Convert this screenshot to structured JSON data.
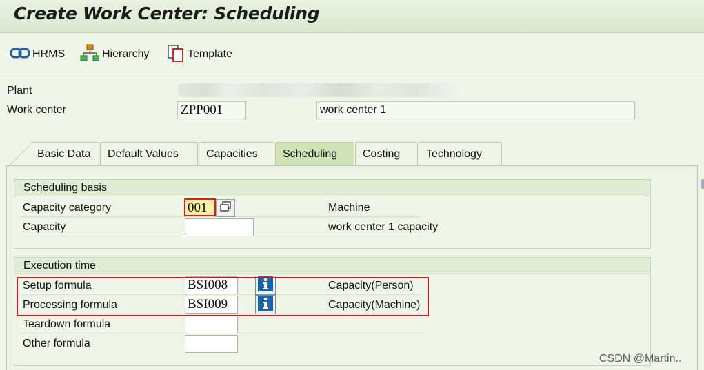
{
  "window": {
    "title": "Create Work Center: Scheduling"
  },
  "toolbar": {
    "hrms_label": "HRMS",
    "hierarchy_label": "Hierarchy",
    "template_label": "Template"
  },
  "header": {
    "plant_label": "Plant",
    "work_center_label": "Work center",
    "work_center_value": "ZPP001",
    "work_center_desc": "work center 1"
  },
  "tabs": [
    {
      "label": "Basic Data"
    },
    {
      "label": "Default Values"
    },
    {
      "label": "Capacities"
    },
    {
      "label": "Scheduling",
      "active": true
    },
    {
      "label": "Costing"
    },
    {
      "label": "Technology"
    }
  ],
  "scheduling_basis": {
    "title": "Scheduling basis",
    "capacity_category_label": "Capacity category",
    "capacity_category_value": "001",
    "capacity_category_desc": "Machine",
    "capacity_label": "Capacity",
    "capacity_value": "",
    "capacity_desc": "work center 1  capacity"
  },
  "execution_time": {
    "title": "Execution time",
    "setup_label": "Setup formula",
    "setup_value": "BSI008",
    "setup_desc": "Capacity(Person)",
    "processing_label": "Processing formula",
    "processing_value": "BSI009",
    "processing_desc": "Capacity(Machine)",
    "teardown_label": "Teardown formula",
    "teardown_value": "",
    "other_label": "Other formula",
    "other_value": ""
  },
  "watermark": "CSDN @Martin..",
  "colors": {
    "background": "#eef4e8",
    "active_tab": "#cfe3b6",
    "highlight_field": "#fbf0a8",
    "annotation_red": "#d21f26"
  }
}
